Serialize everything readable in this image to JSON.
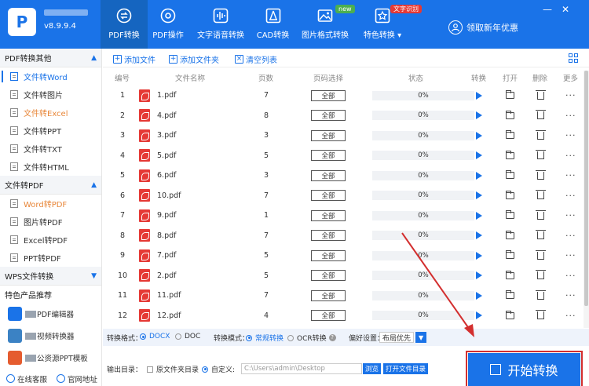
{
  "app": {
    "version": "v8.9.9.4"
  },
  "nav": [
    {
      "label": "PDF转换",
      "icon": "convert-icon",
      "active": true
    },
    {
      "label": "PDF操作",
      "icon": "settings-icon",
      "active": false
    },
    {
      "label": "文字语音转换",
      "icon": "audio-wave-icon",
      "active": false
    },
    {
      "label": "CAD转换",
      "icon": "cad-icon",
      "active": false
    },
    {
      "label": "图片格式转换",
      "icon": "image-icon",
      "active": false,
      "badge": "new"
    },
    {
      "label": "特色转换 ▾",
      "icon": "star-convert-icon",
      "active": false,
      "badge": "文字识别"
    }
  ],
  "user": {
    "label": "领取新年优惠"
  },
  "sidebar": {
    "sections": [
      {
        "title": "PDF转换其他",
        "items": [
          "文件转Word",
          "文件转图片",
          "文件转Excel",
          "文件转PPT",
          "文件转TXT",
          "文件转HTML"
        ]
      },
      {
        "title": "文件转PDF",
        "items": [
          "Word转PDF",
          "图片转PDF",
          "Excel转PDF",
          "PPT转PDF"
        ]
      },
      {
        "title": "WPS文件转换",
        "items": []
      }
    ],
    "featured_title": "特色产品推荐",
    "featured": [
      "PDF编辑器",
      "视频转换器",
      "公资源PPT模板"
    ],
    "footer": {
      "service": "在线客服",
      "website": "官网地址"
    }
  },
  "toolbar": {
    "add_file": "添加文件",
    "add_folder": "添加文件夹",
    "clear_list": "清空列表"
  },
  "table": {
    "headers": [
      "编号",
      "文件名称",
      "页数",
      "页码选择",
      "状态",
      "转换",
      "打开",
      "删除",
      "更多"
    ],
    "range_label": "全部",
    "rows": [
      {
        "num": "1",
        "name": "1.pdf",
        "pages": "7",
        "status": "0%"
      },
      {
        "num": "2",
        "name": "4.pdf",
        "pages": "8",
        "status": "0%"
      },
      {
        "num": "3",
        "name": "3.pdf",
        "pages": "3",
        "status": "0%"
      },
      {
        "num": "4",
        "name": "5.pdf",
        "pages": "5",
        "status": "0%"
      },
      {
        "num": "5",
        "name": "6.pdf",
        "pages": "3",
        "status": "0%"
      },
      {
        "num": "6",
        "name": "10.pdf",
        "pages": "7",
        "status": "0%"
      },
      {
        "num": "7",
        "name": "9.pdf",
        "pages": "1",
        "status": "0%"
      },
      {
        "num": "8",
        "name": "8.pdf",
        "pages": "7",
        "status": "0%"
      },
      {
        "num": "9",
        "name": "7.pdf",
        "pages": "5",
        "status": "0%"
      },
      {
        "num": "10",
        "name": "2.pdf",
        "pages": "5",
        "status": "0%"
      },
      {
        "num": "11",
        "name": "11.pdf",
        "pages": "7",
        "status": "0%"
      },
      {
        "num": "12",
        "name": "12.pdf",
        "pages": "4",
        "status": "0%"
      }
    ]
  },
  "options": {
    "format_label": "转换格式：",
    "format_docx": "DOCX",
    "format_doc": "DOC",
    "mode_label": "转换模式：",
    "mode_normal": "常规转换",
    "mode_ocr": "OCR转换",
    "pref_label": "偏好设置：",
    "pref_value": "布局优先",
    "output_label": "输出目录：",
    "output_original": "原文件夹目录",
    "output_custom": "自定义:",
    "output_path": "C:\\Users\\admin\\Desktop",
    "browse": "浏览",
    "open_folder": "打开文件目录"
  },
  "start_button": "开始转换",
  "colors": {
    "primary": "#1a73e8",
    "pdf_red": "#e53935",
    "orange": "#e8873a",
    "annotation_red": "#d32f2f"
  }
}
